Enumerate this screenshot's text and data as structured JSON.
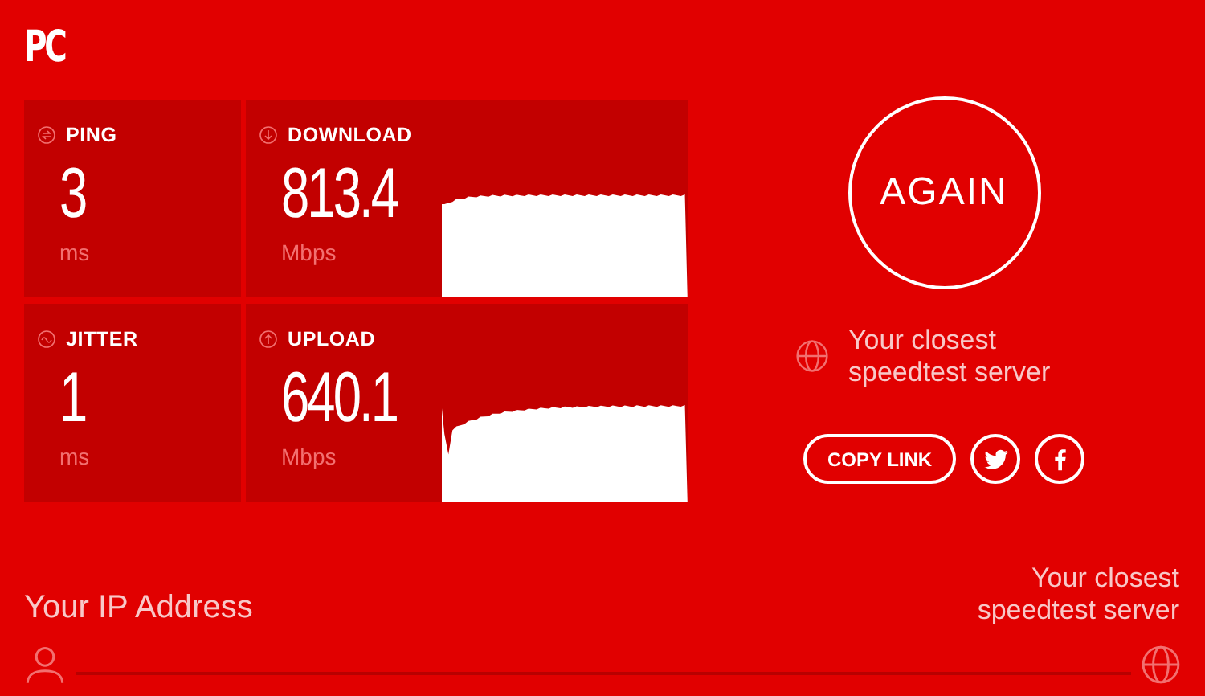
{
  "logo": "PC",
  "metrics": [
    {
      "kind": "ping",
      "label": "PING",
      "value": "3",
      "unit": "ms"
    },
    {
      "kind": "download",
      "label": "DOWNLOAD",
      "value": "813.4",
      "unit": "Mbps"
    },
    {
      "kind": "jitter",
      "label": "JITTER",
      "value": "1",
      "unit": "ms"
    },
    {
      "kind": "upload",
      "label": "UPLOAD",
      "value": "640.1",
      "unit": "Mbps"
    }
  ],
  "again_button": "AGAIN",
  "server": {
    "text": "Your closest speedtest server"
  },
  "share": {
    "copy_link": "COPY LINK",
    "networks": [
      {
        "kind": "twitter"
      },
      {
        "kind": "facebook"
      }
    ]
  },
  "footer": {
    "ip_label": "Your IP Address",
    "server_label": "Your closest speedtest server"
  }
}
